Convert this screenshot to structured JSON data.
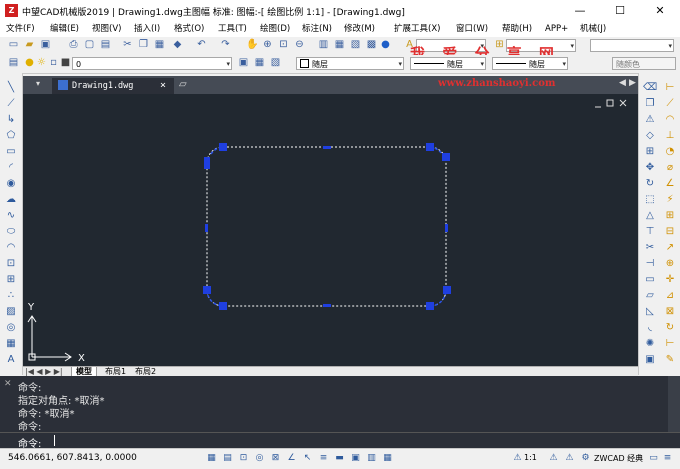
{
  "title": {
    "app_icon": "Z",
    "text": "中望CAD机械版2019 | Drawing1.dwg主图幅  标准: 图幅:-[ 绘图比例 1:1] - [Drawing1.dwg]",
    "minimize": "—",
    "maximize": "☐",
    "close": "✕"
  },
  "menu": [
    "文件(F)",
    "编辑(E)",
    "视图(V)",
    "插入(I)",
    "格式(O)",
    "工具(T)",
    "绘图(D)",
    "标注(N)",
    "修改(M)",
    "扩展工具(X)",
    "窗口(W)",
    "帮助(H)",
    "APP+",
    "机械(J)"
  ],
  "toolbar2": {
    "layer_value": "0",
    "color_value": "随层",
    "linetype_value": "随层",
    "lineweight_value": "随层",
    "plotstyle_value": "随颜色"
  },
  "watermark": {
    "text": "我 爱 分 享 网",
    "url": "www.zhanshaoyi.com"
  },
  "document_tab": {
    "label": "Drawing1.dwg",
    "close": "×"
  },
  "canvas": {
    "ucs_y": "Y",
    "ucs_x": "X",
    "background": "#212830",
    "grip_color": "#1f3fe0"
  },
  "layout_tabs": [
    "模型",
    "布局1",
    "布局2"
  ],
  "command": {
    "history": [
      "命令:",
      "指定对角点: *取消*",
      "命令: *取消*",
      "命令:"
    ],
    "prompt": "命令:"
  },
  "status": {
    "coordinates": "546.0661, 607.8413, 0.0000",
    "scale": "1:1",
    "brand": "ZWCAD 经典"
  }
}
